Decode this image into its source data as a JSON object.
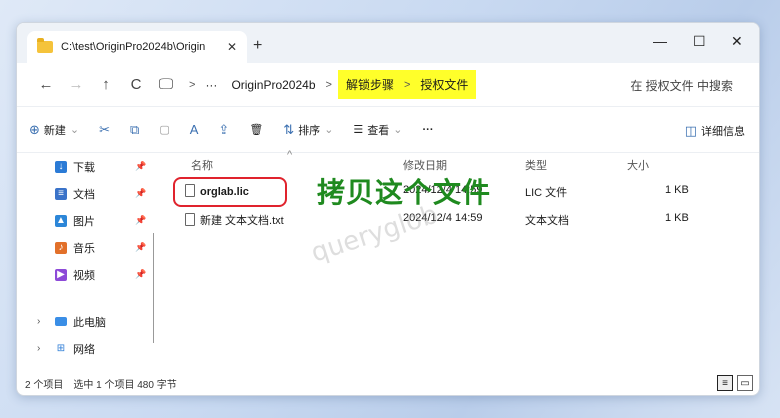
{
  "tab": {
    "title": "C:\\test\\OriginPro2024b\\Origin",
    "close": "✕",
    "new": "+"
  },
  "window_controls": {
    "minimize": "—",
    "maximize": "☐",
    "close": "✕"
  },
  "nav": {
    "back": "←",
    "forward": "→",
    "up": "↑",
    "refresh": "C",
    "device": "🖵",
    "arrow": ">",
    "more": "···"
  },
  "breadcrumb": {
    "root": "OriginPro2024b",
    "step": "解锁步骤",
    "license": "授权文件",
    "sep": ">"
  },
  "search": {
    "placeholder": "在 授权文件 中搜索"
  },
  "toolbar": {
    "new": "新建",
    "cut_icon": "✂",
    "copy_icon": "⧉",
    "paste_icon": "▢",
    "rename_icon": "A",
    "share_icon": "⇪",
    "delete_icon": "🗑",
    "sort": "排序",
    "view": "查看",
    "more": "···",
    "details": "详细信息"
  },
  "sidebar": {
    "quick": [
      {
        "label": "下载",
        "icon": "↓",
        "color": "#2b7bd6"
      },
      {
        "label": "文档",
        "icon": "≡",
        "color": "#3a73c9"
      },
      {
        "label": "图片",
        "icon": "▲",
        "color": "#2c86d8"
      },
      {
        "label": "音乐",
        "icon": "♪",
        "color": "#e2702a"
      },
      {
        "label": "视频",
        "icon": "▶",
        "color": "#8d4ad8"
      }
    ],
    "pin": "📌",
    "this_pc": "此电脑",
    "network": "网络"
  },
  "table": {
    "headers": {
      "name": "名称",
      "date": "修改日期",
      "type": "类型",
      "size": "大小"
    },
    "rows": [
      {
        "name": "orglab.lic",
        "date": "2024/12/4 14:59",
        "type": "LIC 文件",
        "size": "1 KB"
      },
      {
        "name": "新建 文本文档.txt",
        "date": "2024/12/4 14:59",
        "type": "文本文档",
        "size": "1 KB"
      }
    ]
  },
  "annotation": "拷贝这个文件",
  "watermark": "queryglob",
  "status": {
    "count": "2 个项目",
    "selected": "选中 1 个项目 480 字节"
  },
  "colors": {
    "highlight": "#ffff2a",
    "annotation": "#1f8a1f",
    "ring": "#e0232d"
  }
}
